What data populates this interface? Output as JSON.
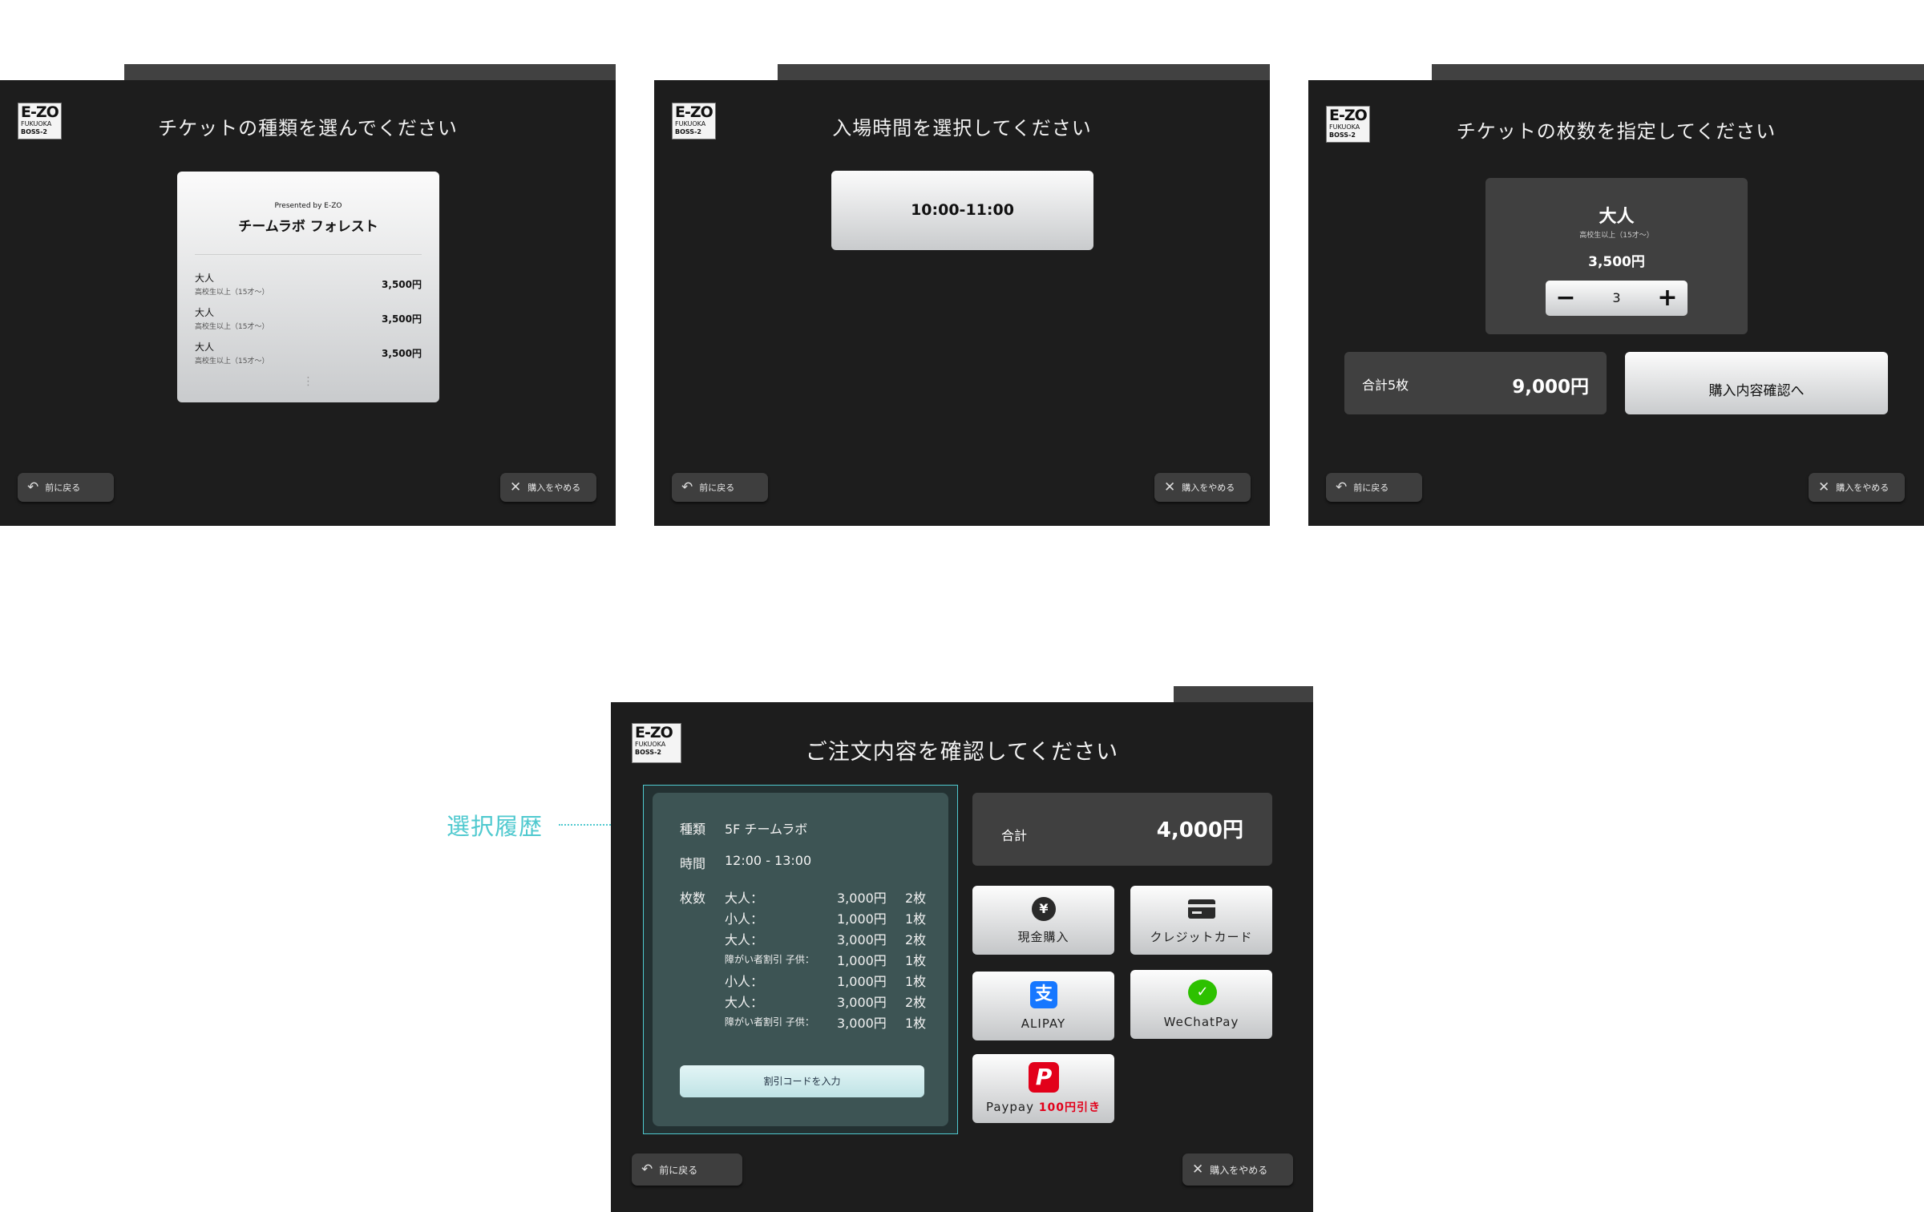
{
  "brand": {
    "logo_line1": "E-ZO",
    "logo_line2": "FUKUOKA",
    "logo_line3": "BOSS-2"
  },
  "common": {
    "back_label": "前に戻る",
    "cancel_label": "購入をやめる"
  },
  "screen1": {
    "title": "チケットの種類を選んでください",
    "card_presented": "Presented by E-ZO",
    "card_name": "チームラボ フォレスト",
    "rows": [
      {
        "name": "大人",
        "sub": "高校生以上（15才〜）",
        "price": "3,500円"
      },
      {
        "name": "大人",
        "sub": "高校生以上（15才〜）",
        "price": "3,500円"
      },
      {
        "name": "大人",
        "sub": "高校生以上（15才〜）",
        "price": "3,500円"
      }
    ],
    "more": "⋮"
  },
  "screen2": {
    "title": "入場時間を選択してください",
    "slot": "10:00-11:00"
  },
  "screen3": {
    "title": "チケットの枚数を指定してください",
    "ticket_name": "大人",
    "ticket_sub": "高校生以上（15才〜）",
    "ticket_price": "3,500円",
    "qty": "3",
    "minus": "−",
    "plus": "+",
    "total_label": "合計5枚",
    "total_price": "9,000円",
    "confirm_label": "購入内容確認へ"
  },
  "screen4": {
    "title": "ご注文内容を確認してください",
    "annotation": "選択履歴",
    "kind_label": "種類",
    "kind_value": "5F チームラボ",
    "time_label": "時間",
    "time_value": "12:00 - 13:00",
    "count_label": "枚数",
    "items": [
      {
        "label": "大人：",
        "price": "3,000円",
        "count": "2枚"
      },
      {
        "label": "小人：",
        "price": "1,000円",
        "count": "1枚"
      },
      {
        "label": "大人：",
        "price": "3,000円",
        "count": "2枚"
      },
      {
        "label": "障がい者割引 子供：",
        "price": "1,000円",
        "count": "1枚"
      },
      {
        "label": "小人：",
        "price": "1,000円",
        "count": "1枚"
      },
      {
        "label": "大人：",
        "price": "3,000円",
        "count": "2枚"
      },
      {
        "label": "障がい者割引 子供：",
        "price": "3,000円",
        "count": "1枚"
      }
    ],
    "discount_label": "割引コードを入力",
    "total_label": "合計",
    "total_value": "4,000円",
    "payments": {
      "cash": "現金購入",
      "credit": "クレジットカード",
      "alipay": "ALIPAY",
      "wechat": "WeChatPay",
      "paypay_name": "Paypay",
      "paypay_discount": "100円引き"
    }
  },
  "colors": {
    "screen_bg": "#1d1d1d",
    "tab": "#414141",
    "accent_teal": "#4fc9cf",
    "order_panel": "#3d5454",
    "paypay_red": "#e2001a"
  }
}
